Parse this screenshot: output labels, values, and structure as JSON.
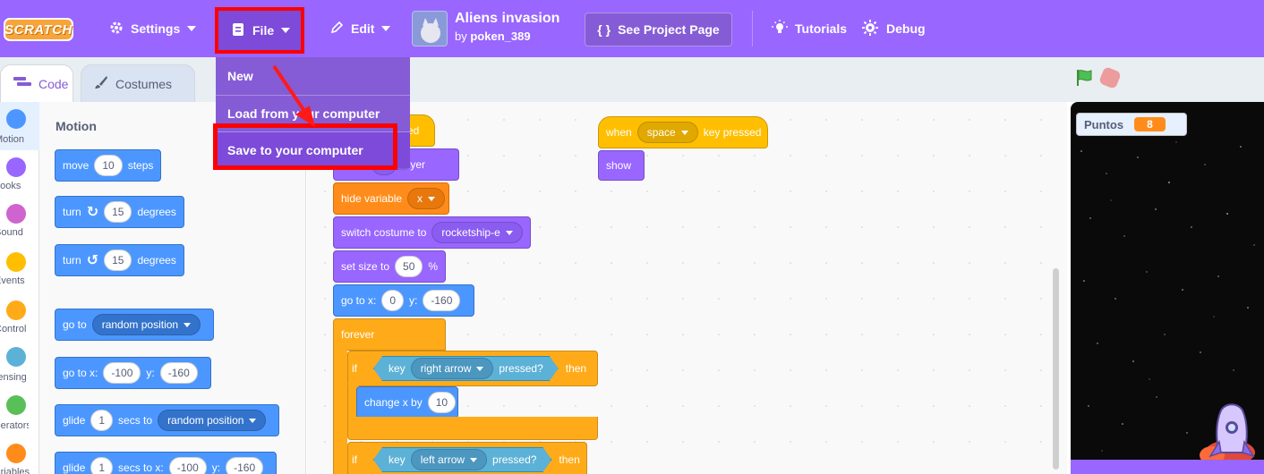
{
  "menubar": {
    "logo": "SCRATCH",
    "settings": "Settings",
    "file": "File",
    "edit": "Edit",
    "project_title": "Aliens invasion",
    "by_prefix": "by",
    "author": "poken_389",
    "see_project_page": "See Project Page",
    "tutorials": "Tutorials",
    "debug": "Debug"
  },
  "file_menu": {
    "items": [
      "New",
      "Load from your computer",
      "Save to your computer"
    ],
    "highlighted": "Save to your computer"
  },
  "tabs": [
    {
      "label": "Code",
      "active": true
    },
    {
      "label": "Costumes",
      "active": false
    }
  ],
  "categories": [
    {
      "label": "Motion",
      "color": "#4c97ff"
    },
    {
      "label": "Looks",
      "color": "#9966ff"
    },
    {
      "label": "Sound",
      "color": "#cf63cf"
    },
    {
      "label": "Events",
      "color": "#ffbf00"
    },
    {
      "label": "Control",
      "color": "#ffab19"
    },
    {
      "label": "Sensing",
      "color": "#5cb1d6"
    },
    {
      "label": "Operators",
      "color": "#59c059"
    },
    {
      "label": "Variables",
      "color": "#ff8c1a"
    }
  ],
  "palette": {
    "heading": "Motion",
    "move": {
      "a": "move",
      "v": "10",
      "b": "steps"
    },
    "turn_right": {
      "a": "turn",
      "v": "15",
      "b": "degrees"
    },
    "turn_left": {
      "a": "turn",
      "v": "15",
      "b": "degrees"
    },
    "goto": {
      "a": "go to",
      "d": "random position"
    },
    "gotoxy": {
      "a": "go to x:",
      "x": "-100",
      "b": "y:",
      "y": "-160"
    },
    "glide": {
      "a": "glide",
      "v": "1",
      "b": "secs to",
      "d": "random position"
    },
    "glidexy": {
      "a": "glide",
      "v": "1",
      "b": "secs to x:",
      "x": "-100",
      "c": "y:",
      "y": "-160"
    }
  },
  "script1": {
    "hat_tail": "ked",
    "layer": "layer",
    "hide_var": "hide variable",
    "hide_var_name": "x",
    "switch_costume": "switch costume to",
    "costume_name": "rocketship-e",
    "set_size": "set size to",
    "size_val": "50",
    "size_unit": "%",
    "goto_x": "go to x:",
    "x_val": "0",
    "y_label": "y:",
    "y_val": "-160",
    "forever": "forever",
    "if1": "if",
    "key1": "key",
    "key1_name": "right arrow",
    "pressed1": "pressed?",
    "then1": "then",
    "change_x": "change x by",
    "change_val": "10",
    "if2": "if",
    "key2": "key",
    "key2_name": "left arrow",
    "pressed2": "pressed?",
    "then2": "then"
  },
  "script2": {
    "when": "when",
    "key": "space",
    "key_pressed": "key pressed",
    "show": "show"
  },
  "stage": {
    "monitor_label": "Puntos",
    "monitor_value": "8"
  }
}
